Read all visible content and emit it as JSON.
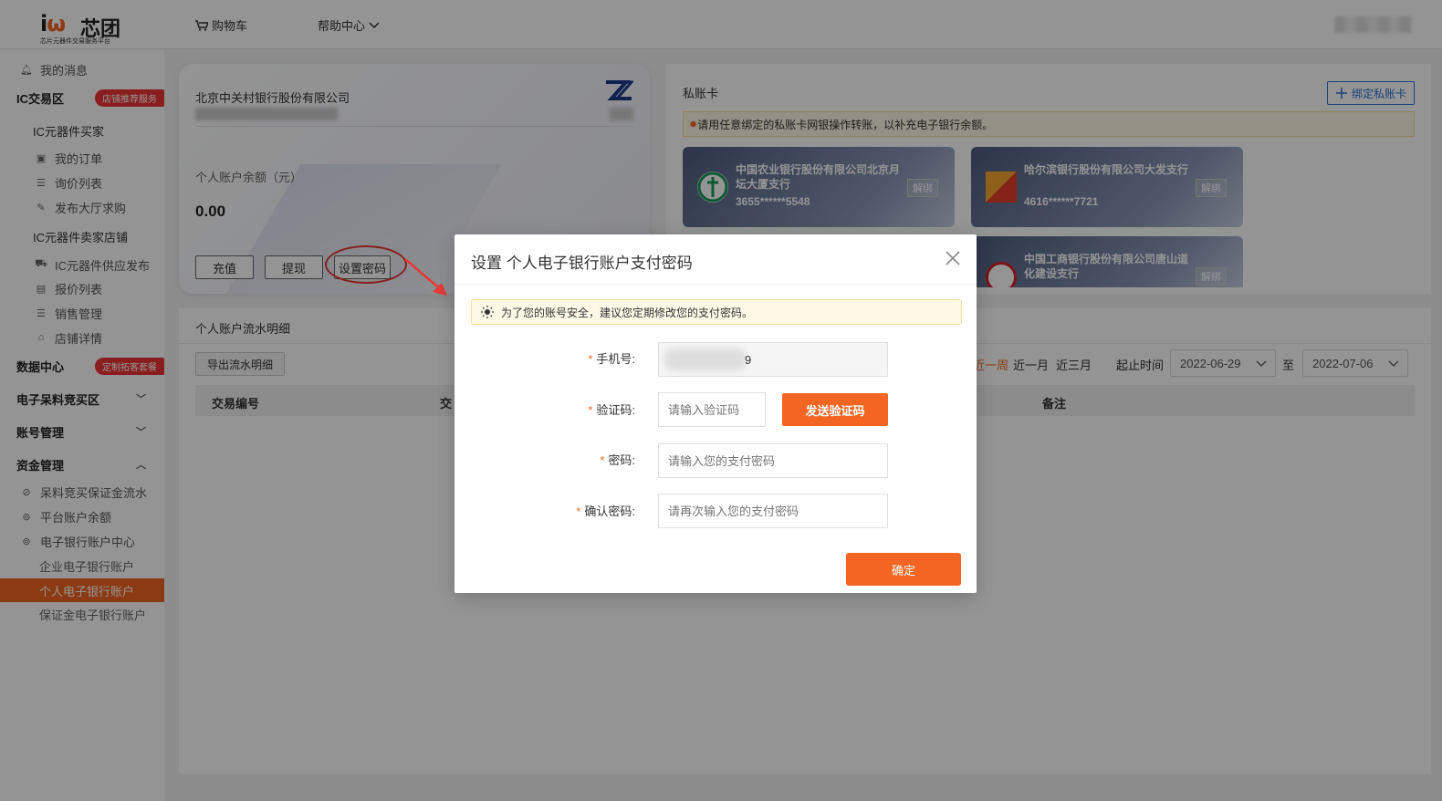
{
  "header": {
    "logo_text": "芯团",
    "logo_subtitle": "芯片元器件交易服务平台",
    "cart_label": "购物车",
    "help_label": "帮助中心"
  },
  "sidebar": {
    "messages": "我的消息",
    "ic_zone": "IC交易区",
    "ic_zone_tag": "店铺推荐服务",
    "buyer_group": "IC元器件买家",
    "my_orders": "我的订单",
    "inquiry_list": "询价列表",
    "post_purchase": "发布大厅求购",
    "seller_group": "IC元器件卖家店铺",
    "supply_post": "IC元器件供应发布",
    "quote_list": "报价列表",
    "sales_mgmt": "销售管理",
    "shop_detail": "店铺详情",
    "data_center": "数据中心",
    "data_center_tag": "定制拓客套餐",
    "scrap_zone": "电子呆料竞买区",
    "account_mgmt": "账号管理",
    "fund_mgmt": "资金管理",
    "deposit_flow": "呆料竞买保证金流水",
    "platform_balance": "平台账户余额",
    "ebank_center": "电子银行账户中心",
    "enterprise_ebank": "企业电子银行账户",
    "personal_ebank": "个人电子银行账户",
    "deposit_ebank": "保证金电子银行账户"
  },
  "bank_card": {
    "bank_name": "北京中关村银行股份有限公司",
    "balance_label": "个人账户余额（元）",
    "balance_value": "0.00",
    "recharge": "充值",
    "withdraw": "提现",
    "set_password": "设置密码"
  },
  "private_panel": {
    "title": "私账卡",
    "bind_button": "绑定私账卡",
    "notice": "请用任意绑定的私账卡网银操作转账，以补充电子银行余额。",
    "cards": [
      {
        "name": "中国农业银行股份有限公司北京月坛大厦支行",
        "number": "3655******5548",
        "unbind": "解绑"
      },
      {
        "name": "哈尔滨银行股份有限公司大发支行",
        "number": "4616******7721",
        "unbind": "解绑"
      },
      {
        "name": "中国工商银行股份有限公司唐山道化建设支行",
        "number": "",
        "unbind": "解绑"
      }
    ]
  },
  "flow_panel": {
    "title": "个人账户流水明细",
    "export": "导出流水明细",
    "range_week": "近一周",
    "range_month": "近一月",
    "range_quarter": "近三月",
    "start_label": "起止时间",
    "start_date": "2022-06-29",
    "to_label": "至",
    "end_date": "2022-07-06",
    "columns": [
      "交易编号",
      "交",
      "备注"
    ]
  },
  "dialog": {
    "title": "设置 个人电子银行账户支付密码",
    "tip": "为了您的账号安全，建议您定期修改您的支付密码。",
    "phone_label": "手机号:",
    "phone_value_tail": "9",
    "code_label": "验证码:",
    "code_placeholder": "请输入验证码",
    "send_code": "发送验证码",
    "password_label": "密码:",
    "password_placeholder": "请输入您的支付密码",
    "confirm_label": "确认密码:",
    "confirm_placeholder": "请再次输入您的支付密码",
    "ok": "确定",
    "required_mark": "*"
  },
  "colors": {
    "accent": "#f26522",
    "link_blue": "#2d6fd6",
    "annotation_red": "#e53935"
  }
}
